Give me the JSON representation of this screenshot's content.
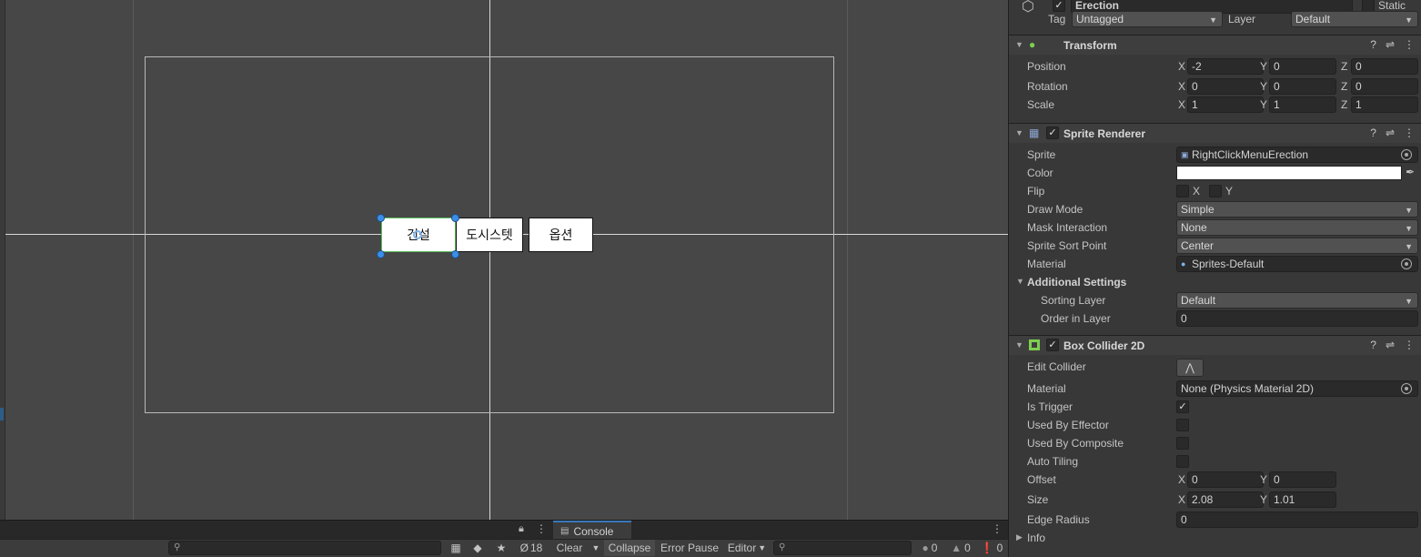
{
  "scene": {
    "buttons": [
      {
        "label": "건설"
      },
      {
        "label": "도시스텟"
      },
      {
        "label": "옵션"
      }
    ]
  },
  "console": {
    "tab_label": "Console",
    "hidden_count": "18",
    "clear_label": "Clear",
    "collapse_label": "Collapse",
    "error_pause_label": "Error Pause",
    "editor_label": "Editor",
    "info_count": "0",
    "warning_count": "0",
    "error_count": "0"
  },
  "inspector": {
    "object": {
      "name": "Erection",
      "static_label": "Static",
      "tag_label": "Tag",
      "tag_value": "Untagged",
      "layer_label": "Layer",
      "layer_value": "Default"
    },
    "transform": {
      "title": "Transform",
      "position_label": "Position",
      "rotation_label": "Rotation",
      "scale_label": "Scale",
      "axis_x": "X",
      "axis_y": "Y",
      "axis_z": "Z",
      "position": [
        "-2",
        "0",
        "0"
      ],
      "rotation": [
        "0",
        "0",
        "0"
      ],
      "scale": [
        "1",
        "1",
        "1"
      ]
    },
    "sprite_renderer": {
      "title": "Sprite Renderer",
      "sprite_label": "Sprite",
      "sprite_value": "RightClickMenuErection",
      "color_label": "Color",
      "color_value": "#ffffff",
      "flip_label": "Flip",
      "flip_x": "X",
      "flip_y": "Y",
      "draw_mode_label": "Draw Mode",
      "draw_mode_value": "Simple",
      "mask_label": "Mask Interaction",
      "mask_value": "None",
      "sort_point_label": "Sprite Sort Point",
      "sort_point_value": "Center",
      "material_label": "Material",
      "material_value": "Sprites-Default",
      "additional_label": "Additional Settings",
      "sorting_layer_label": "Sorting Layer",
      "sorting_layer_value": "Default",
      "order_label": "Order in Layer",
      "order_value": "0"
    },
    "box_collider": {
      "title": "Box Collider 2D",
      "edit_collider_label": "Edit Collider",
      "material_label": "Material",
      "material_value": "None (Physics Material 2D)",
      "is_trigger_label": "Is Trigger",
      "used_by_effector_label": "Used By Effector",
      "used_by_composite_label": "Used By Composite",
      "auto_tiling_label": "Auto Tiling",
      "offset_label": "Offset",
      "offset": [
        "0",
        "0"
      ],
      "size_label": "Size",
      "size": [
        "2.08",
        "1.01"
      ],
      "edge_radius_label": "Edge Radius",
      "edge_radius_value": "0",
      "info_label": "Info",
      "is_trigger": true,
      "used_by_effector": false,
      "used_by_composite": false,
      "auto_tiling": false
    }
  }
}
